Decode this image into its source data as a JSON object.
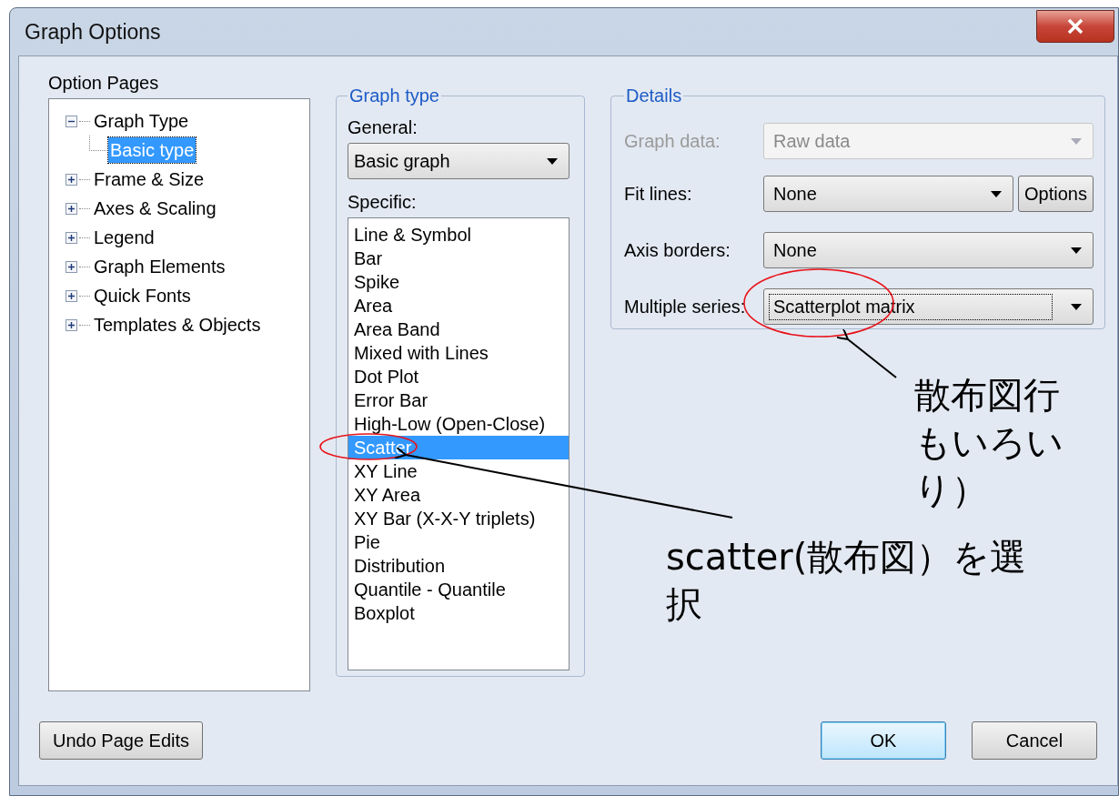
{
  "window": {
    "title": "Graph Options"
  },
  "option_pages": {
    "label": "Option Pages",
    "tree": [
      {
        "label": "Graph Type",
        "expanded": true,
        "selected": false,
        "children": [
          {
            "label": "Basic type",
            "selected": true
          }
        ]
      },
      {
        "label": "Frame & Size",
        "expanded": false,
        "selected": false
      },
      {
        "label": "Axes & Scaling",
        "expanded": false,
        "selected": false
      },
      {
        "label": "Legend",
        "expanded": false,
        "selected": false
      },
      {
        "label": "Graph Elements",
        "expanded": false,
        "selected": false
      },
      {
        "label": "Quick Fonts",
        "expanded": false,
        "selected": false
      },
      {
        "label": "Templates & Objects",
        "expanded": false,
        "selected": false
      }
    ]
  },
  "graph_type": {
    "legend": "Graph type",
    "general_label": "General:",
    "general_value": "Basic graph",
    "specific_label": "Specific:",
    "specific": [
      {
        "label": "Line & Symbol",
        "selected": false
      },
      {
        "label": "Bar",
        "selected": false
      },
      {
        "label": "Spike",
        "selected": false
      },
      {
        "label": "Area",
        "selected": false
      },
      {
        "label": "Area Band",
        "selected": false
      },
      {
        "label": "Mixed with Lines",
        "selected": false
      },
      {
        "label": "Dot Plot",
        "selected": false
      },
      {
        "label": "Error Bar",
        "selected": false
      },
      {
        "label": "High-Low (Open-Close)",
        "selected": false
      },
      {
        "label": "Scatter",
        "selected": true
      },
      {
        "label": "XY Line",
        "selected": false
      },
      {
        "label": "XY Area",
        "selected": false
      },
      {
        "label": "XY Bar (X-X-Y triplets)",
        "selected": false
      },
      {
        "label": "Pie",
        "selected": false
      },
      {
        "label": "Distribution",
        "selected": false
      },
      {
        "label": "Quantile - Quantile",
        "selected": false
      },
      {
        "label": "Boxplot",
        "selected": false
      }
    ]
  },
  "details": {
    "legend": "Details",
    "rows": [
      {
        "label": "Graph data:",
        "value": "Raw data",
        "disabled": true,
        "focused": false
      },
      {
        "label": "Fit lines:",
        "value": "None",
        "disabled": false,
        "focused": false,
        "button": "Options"
      },
      {
        "label": "Axis borders:",
        "value": "None",
        "disabled": false,
        "focused": false
      },
      {
        "label": "Multiple series:",
        "value": "Scatterplot matrix",
        "disabled": false,
        "focused": true
      }
    ]
  },
  "buttons": [
    {
      "label": "Undo Page Edits",
      "default": false
    },
    {
      "label": "OK",
      "default": true
    },
    {
      "label": "Cancel",
      "default": false
    }
  ],
  "annotations": [
    {
      "lines": [
        "散布図行",
        "もいろい",
        "り）"
      ]
    },
    {
      "lines": [
        "scatter(散布図）を選",
        "択"
      ]
    }
  ]
}
